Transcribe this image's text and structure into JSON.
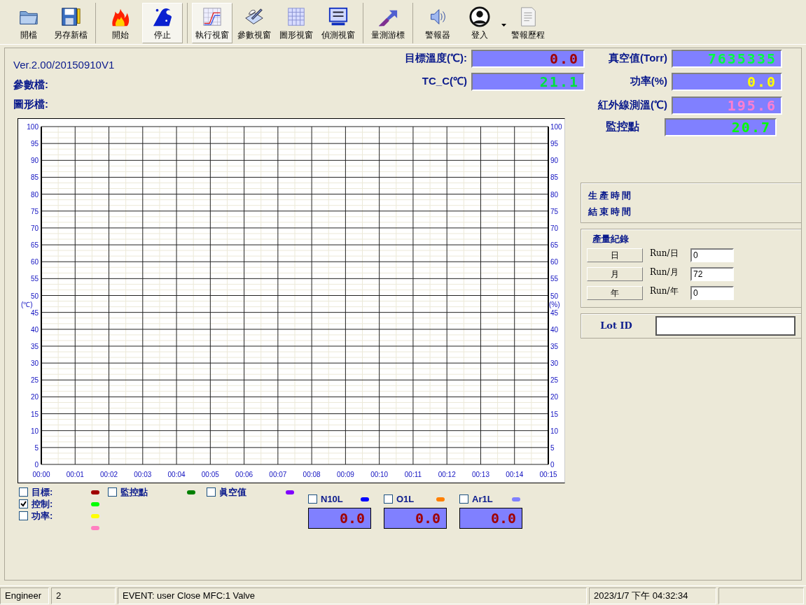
{
  "toolbar": {
    "groups": [
      {
        "buttons": [
          {
            "label": "開檔",
            "pressed": false
          },
          {
            "label": "另存新檔",
            "pressed": false
          }
        ]
      },
      {
        "buttons": [
          {
            "label": "開始",
            "pressed": false
          },
          {
            "label": "停止",
            "pressed": true
          }
        ]
      },
      {
        "buttons": [
          {
            "label": "執行視窗",
            "pressed": true
          },
          {
            "label": "參數視窗",
            "pressed": false
          },
          {
            "label": "圖形視窗",
            "pressed": false
          },
          {
            "label": "偵測視窗",
            "pressed": false
          }
        ]
      },
      {
        "buttons": [
          {
            "label": "量測游標",
            "pressed": false
          }
        ]
      },
      {
        "buttons": [
          {
            "label": "警報器",
            "pressed": false
          },
          {
            "label": "登入",
            "pressed": false,
            "dropdown": true
          },
          {
            "label": "警報歷程",
            "pressed": false
          }
        ]
      }
    ]
  },
  "info": {
    "version": "Ver.2.00/20150910V1",
    "lines": [
      "參數檔:",
      "圖形檔:"
    ]
  },
  "readouts": [
    {
      "label": "目標溫度(℃):",
      "value": "0.0",
      "color": "#a00000"
    },
    {
      "label": "真空值(Torr)",
      "value": "7635335",
      "color": "#00ff40"
    },
    {
      "label": "TC_C(℃)",
      "value": "21.1",
      "color": "#00e040"
    },
    {
      "label": "功率(%)",
      "value": "0.0",
      "color": "#ffff00"
    },
    {
      "label": "紅外線測溫(℃)",
      "value": "195.6",
      "color": "#ff7fd0"
    }
  ],
  "chart": {
    "chart_data": {
      "type": "line",
      "ylabel": "(℃)",
      "categories": [
        "00:00",
        "00:01",
        "00:02",
        "00:03",
        "00:04",
        "00:05",
        "00:06",
        "00:07",
        "00:08",
        "00:09",
        "00:10",
        "00:11",
        "00:12",
        "00:13",
        "00:14",
        "00:15"
      ],
      "ylim": [
        0,
        100
      ],
      "yticks": [
        0,
        5,
        10,
        15,
        20,
        25,
        30,
        35,
        40,
        45,
        50,
        55,
        60,
        65,
        70,
        75,
        80,
        85,
        90,
        95,
        100
      ],
      "grid": true
    },
    "right_ylabel": "(%)",
    "right_yticks": [
      "100",
      "95",
      "90",
      "85",
      "80",
      "75",
      "70",
      "65",
      "60",
      "55",
      "50",
      "45",
      "40",
      "35",
      "30",
      "25",
      "20",
      "15",
      "10",
      "5",
      "0"
    ]
  },
  "legend": {
    "columns": [
      [
        {
          "kind": "check",
          "label": "目標:",
          "checked": false,
          "color": "#a00000"
        },
        {
          "kind": "check",
          "label": "控制:",
          "checked": true,
          "color": "#00ff00"
        },
        {
          "kind": "check",
          "label": "功率:",
          "checked": false,
          "color": "#ffff00"
        },
        {
          "kind": "swatch",
          "color": "#ff80c0"
        }
      ],
      [
        {
          "kind": "check",
          "label": "監控點",
          "checked": false,
          "color": "#008000"
        }
      ],
      [
        {
          "kind": "check",
          "label": "眞空值",
          "checked": false,
          "color": "#8000ff"
        }
      ]
    ],
    "gases": [
      {
        "label": "N10L",
        "checked": false,
        "color": "#0000ff",
        "value": "0.0"
      },
      {
        "label": "O1L",
        "checked": false,
        "color": "#ff8000",
        "value": "0.0"
      },
      {
        "label": "Ar1L",
        "checked": false,
        "color": "#8080ff",
        "value": "0.0"
      }
    ]
  },
  "monitor": {
    "label": "監控點",
    "value": "20.7",
    "color": "#00ff00"
  },
  "times": [
    "生產時間",
    "結束時間"
  ],
  "production": {
    "title": "產量紀錄",
    "rows": [
      {
        "button": "日",
        "label": "Run/日",
        "value": "0"
      },
      {
        "button": "月",
        "label": "Run/月",
        "value": "72"
      },
      {
        "button": "年",
        "label": "Run/年",
        "value": "0"
      }
    ]
  },
  "lot": {
    "label": "Lot ID"
  },
  "status_bar": [
    "Engineer",
    "2",
    "EVENT: user Close MFC:1 Valve",
    "2023/1/7 下午 04:32:34"
  ]
}
